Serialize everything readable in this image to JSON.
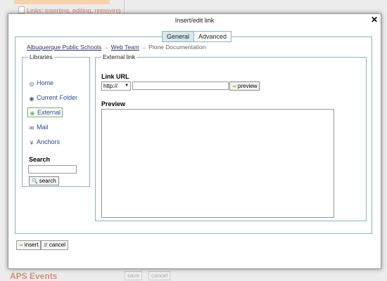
{
  "background": {
    "link_text": "Links: inserting, editing, removing",
    "footer_title": "APS Events",
    "save_label": "save",
    "cancel_label": "cancel"
  },
  "dialog": {
    "title": "Insert/edit link",
    "close_glyph": "✕",
    "tabs": [
      {
        "label": "General",
        "active": true
      },
      {
        "label": "Advanced",
        "active": false
      }
    ],
    "breadcrumb": {
      "items": [
        "Albuquerque Public Schools",
        "Web Team",
        "Plone Documentation"
      ],
      "separator": "→"
    },
    "libraries": {
      "legend": "Libraries",
      "items": [
        {
          "label": "Home",
          "icon": "home-icon"
        },
        {
          "label": "Current Folder",
          "icon": "folder-icon"
        },
        {
          "label": "External",
          "icon": "globe-icon",
          "selected": true
        },
        {
          "label": "Mail",
          "icon": "mail-icon"
        },
        {
          "label": "Anchors",
          "icon": "anchor-icon"
        }
      ],
      "search_label": "Search",
      "search_value": "",
      "search_button": "search"
    },
    "external": {
      "legend": "External link",
      "link_url_label": "Link URL",
      "protocol": "http://",
      "url_value": "",
      "preview_button": "preview",
      "preview_label": "Preview"
    },
    "buttons": {
      "insert": "insert",
      "cancel": "cancel"
    }
  },
  "colors": {
    "border_accent": "#8cb3c0",
    "active_tab": "#d6e7ee",
    "link": "#2a4a8a"
  }
}
